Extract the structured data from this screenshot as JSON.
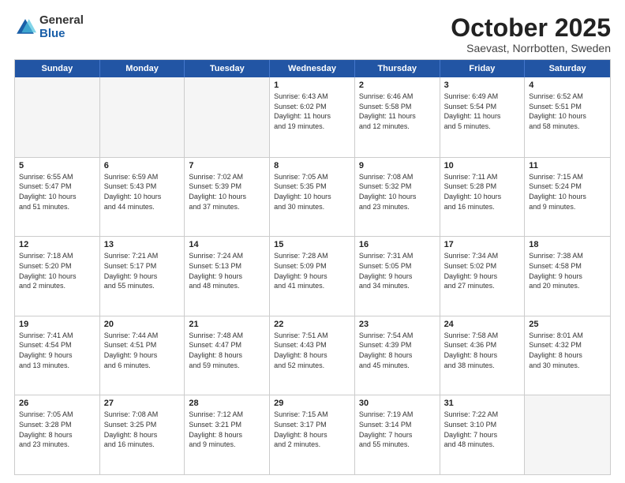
{
  "logo": {
    "general": "General",
    "blue": "Blue"
  },
  "title": "October 2025",
  "subtitle": "Saevast, Norrbotten, Sweden",
  "header_days": [
    "Sunday",
    "Monday",
    "Tuesday",
    "Wednesday",
    "Thursday",
    "Friday",
    "Saturday"
  ],
  "weeks": [
    [
      {
        "day": "",
        "info": ""
      },
      {
        "day": "",
        "info": ""
      },
      {
        "day": "",
        "info": ""
      },
      {
        "day": "1",
        "info": "Sunrise: 6:43 AM\nSunset: 6:02 PM\nDaylight: 11 hours\nand 19 minutes."
      },
      {
        "day": "2",
        "info": "Sunrise: 6:46 AM\nSunset: 5:58 PM\nDaylight: 11 hours\nand 12 minutes."
      },
      {
        "day": "3",
        "info": "Sunrise: 6:49 AM\nSunset: 5:54 PM\nDaylight: 11 hours\nand 5 minutes."
      },
      {
        "day": "4",
        "info": "Sunrise: 6:52 AM\nSunset: 5:51 PM\nDaylight: 10 hours\nand 58 minutes."
      }
    ],
    [
      {
        "day": "5",
        "info": "Sunrise: 6:55 AM\nSunset: 5:47 PM\nDaylight: 10 hours\nand 51 minutes."
      },
      {
        "day": "6",
        "info": "Sunrise: 6:59 AM\nSunset: 5:43 PM\nDaylight: 10 hours\nand 44 minutes."
      },
      {
        "day": "7",
        "info": "Sunrise: 7:02 AM\nSunset: 5:39 PM\nDaylight: 10 hours\nand 37 minutes."
      },
      {
        "day": "8",
        "info": "Sunrise: 7:05 AM\nSunset: 5:35 PM\nDaylight: 10 hours\nand 30 minutes."
      },
      {
        "day": "9",
        "info": "Sunrise: 7:08 AM\nSunset: 5:32 PM\nDaylight: 10 hours\nand 23 minutes."
      },
      {
        "day": "10",
        "info": "Sunrise: 7:11 AM\nSunset: 5:28 PM\nDaylight: 10 hours\nand 16 minutes."
      },
      {
        "day": "11",
        "info": "Sunrise: 7:15 AM\nSunset: 5:24 PM\nDaylight: 10 hours\nand 9 minutes."
      }
    ],
    [
      {
        "day": "12",
        "info": "Sunrise: 7:18 AM\nSunset: 5:20 PM\nDaylight: 10 hours\nand 2 minutes."
      },
      {
        "day": "13",
        "info": "Sunrise: 7:21 AM\nSunset: 5:17 PM\nDaylight: 9 hours\nand 55 minutes."
      },
      {
        "day": "14",
        "info": "Sunrise: 7:24 AM\nSunset: 5:13 PM\nDaylight: 9 hours\nand 48 minutes."
      },
      {
        "day": "15",
        "info": "Sunrise: 7:28 AM\nSunset: 5:09 PM\nDaylight: 9 hours\nand 41 minutes."
      },
      {
        "day": "16",
        "info": "Sunrise: 7:31 AM\nSunset: 5:05 PM\nDaylight: 9 hours\nand 34 minutes."
      },
      {
        "day": "17",
        "info": "Sunrise: 7:34 AM\nSunset: 5:02 PM\nDaylight: 9 hours\nand 27 minutes."
      },
      {
        "day": "18",
        "info": "Sunrise: 7:38 AM\nSunset: 4:58 PM\nDaylight: 9 hours\nand 20 minutes."
      }
    ],
    [
      {
        "day": "19",
        "info": "Sunrise: 7:41 AM\nSunset: 4:54 PM\nDaylight: 9 hours\nand 13 minutes."
      },
      {
        "day": "20",
        "info": "Sunrise: 7:44 AM\nSunset: 4:51 PM\nDaylight: 9 hours\nand 6 minutes."
      },
      {
        "day": "21",
        "info": "Sunrise: 7:48 AM\nSunset: 4:47 PM\nDaylight: 8 hours\nand 59 minutes."
      },
      {
        "day": "22",
        "info": "Sunrise: 7:51 AM\nSunset: 4:43 PM\nDaylight: 8 hours\nand 52 minutes."
      },
      {
        "day": "23",
        "info": "Sunrise: 7:54 AM\nSunset: 4:39 PM\nDaylight: 8 hours\nand 45 minutes."
      },
      {
        "day": "24",
        "info": "Sunrise: 7:58 AM\nSunset: 4:36 PM\nDaylight: 8 hours\nand 38 minutes."
      },
      {
        "day": "25",
        "info": "Sunrise: 8:01 AM\nSunset: 4:32 PM\nDaylight: 8 hours\nand 30 minutes."
      }
    ],
    [
      {
        "day": "26",
        "info": "Sunrise: 7:05 AM\nSunset: 3:28 PM\nDaylight: 8 hours\nand 23 minutes."
      },
      {
        "day": "27",
        "info": "Sunrise: 7:08 AM\nSunset: 3:25 PM\nDaylight: 8 hours\nand 16 minutes."
      },
      {
        "day": "28",
        "info": "Sunrise: 7:12 AM\nSunset: 3:21 PM\nDaylight: 8 hours\nand 9 minutes."
      },
      {
        "day": "29",
        "info": "Sunrise: 7:15 AM\nSunset: 3:17 PM\nDaylight: 8 hours\nand 2 minutes."
      },
      {
        "day": "30",
        "info": "Sunrise: 7:19 AM\nSunset: 3:14 PM\nDaylight: 7 hours\nand 55 minutes."
      },
      {
        "day": "31",
        "info": "Sunrise: 7:22 AM\nSunset: 3:10 PM\nDaylight: 7 hours\nand 48 minutes."
      },
      {
        "day": "",
        "info": ""
      }
    ]
  ]
}
